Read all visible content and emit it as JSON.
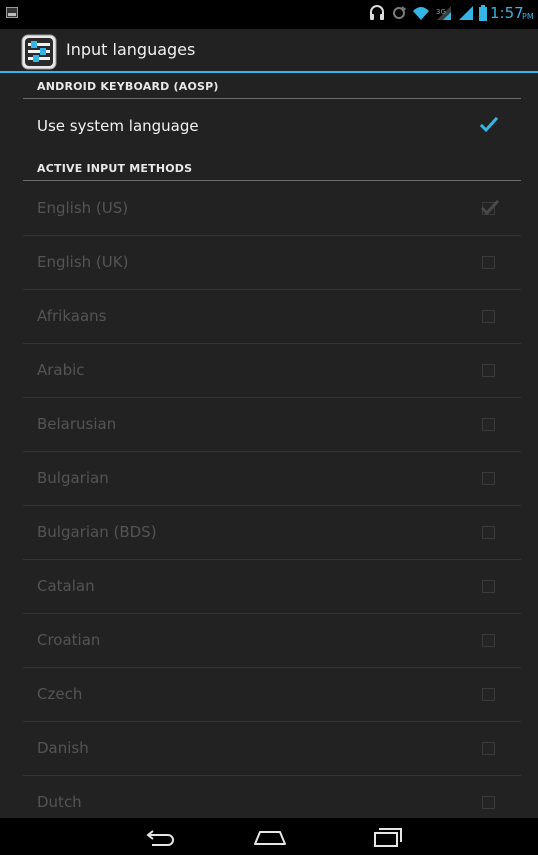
{
  "status_bar": {
    "time": "1:57",
    "ampm": "PM",
    "icons": [
      "image-notification-icon",
      "headset-icon",
      "sync-icon",
      "wifi-icon",
      "signal-icon",
      "signal-icon",
      "battery-icon"
    ],
    "accent_color": "#33b5e5"
  },
  "action_bar": {
    "title": "Input languages",
    "icon": "settings-sliders-icon"
  },
  "sections": {
    "keyboard": {
      "header": "ANDROID KEYBOARD (AOSP)",
      "system_language": {
        "label": "Use system language",
        "checked": true
      }
    },
    "active_methods": {
      "header": "ACTIVE INPUT METHODS",
      "items": [
        {
          "label": "English (US)",
          "checked": true
        },
        {
          "label": "English (UK)",
          "checked": false
        },
        {
          "label": "Afrikaans",
          "checked": false
        },
        {
          "label": "Arabic",
          "checked": false
        },
        {
          "label": "Belarusian",
          "checked": false
        },
        {
          "label": "Bulgarian",
          "checked": false
        },
        {
          "label": "Bulgarian (BDS)",
          "checked": false
        },
        {
          "label": "Catalan",
          "checked": false
        },
        {
          "label": "Croatian",
          "checked": false
        },
        {
          "label": "Czech",
          "checked": false
        },
        {
          "label": "Danish",
          "checked": false
        },
        {
          "label": "Dutch",
          "checked": false
        }
      ]
    }
  },
  "nav_bar": {
    "buttons": [
      "back-icon",
      "home-icon",
      "recent-apps-icon"
    ]
  }
}
